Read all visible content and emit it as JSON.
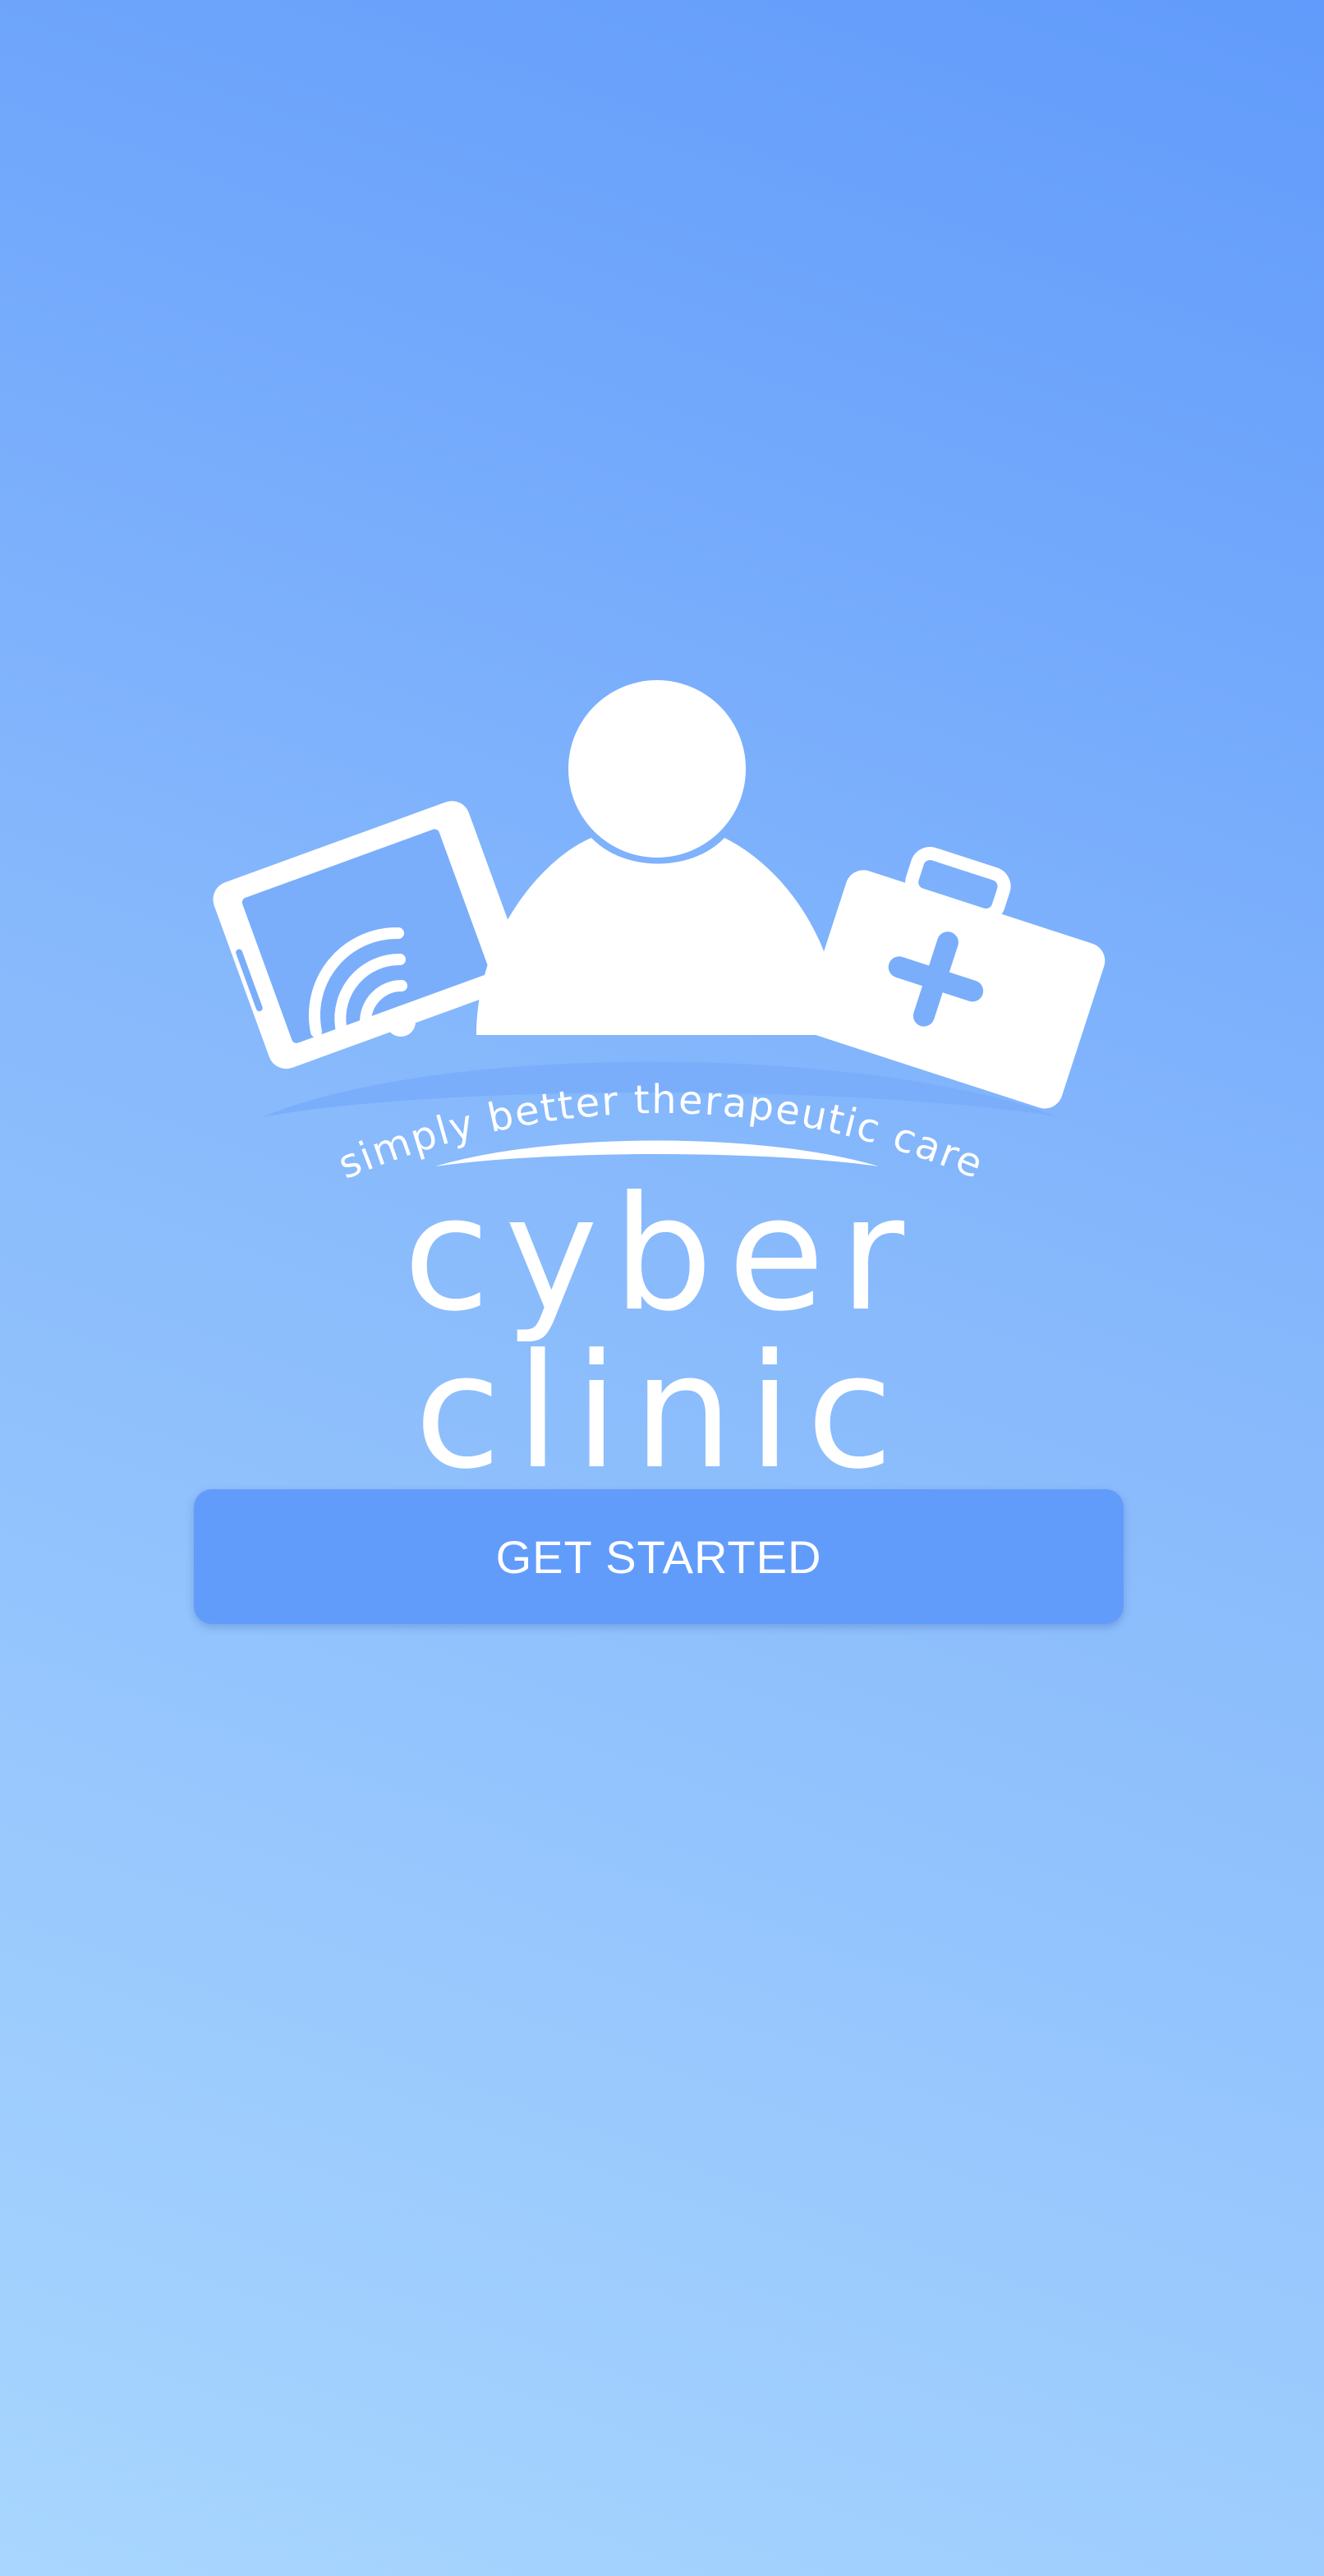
{
  "brand": {
    "name": "cyber clinic",
    "tagline": "simply better therapeutic care"
  },
  "actions": {
    "get_started_label": "GET STARTED"
  },
  "colors": {
    "gradient_top": "#619bfb",
    "gradient_bottom": "#a8d6fe",
    "button": "#629cfb",
    "foreground": "#ffffff"
  },
  "icons": {
    "phone": "phone-wifi-icon",
    "person": "person-icon",
    "medical_kit": "medical-kit-icon"
  }
}
